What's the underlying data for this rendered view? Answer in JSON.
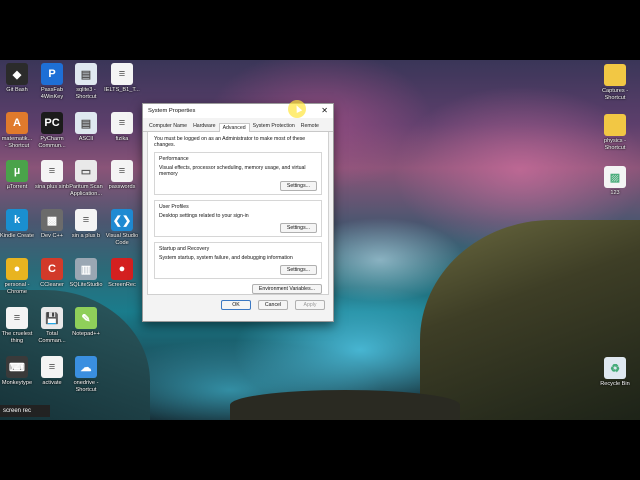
{
  "desktop": {
    "left_icons": [
      {
        "label": "Git Bash",
        "icon": "git-bash-icon",
        "color": "#2b2b2b",
        "glyph": "◆"
      },
      {
        "label": "PassFab\n4WinKey",
        "icon": "passfab-icon",
        "color": "#1e6fd6",
        "glyph": "P"
      },
      {
        "label": "sqlite3 -\nShortcut",
        "icon": "sqlite-icon",
        "color": "#dfe8f0",
        "glyph": "▤"
      },
      {
        "label": "IELTS_B1_T...",
        "icon": "document-icon",
        "color": "#f4f4f4",
        "glyph": "≡"
      },
      {
        "label": "matematik...\n- Shortcut",
        "icon": "pdf-icon",
        "color": "#e07a2c",
        "glyph": "A"
      },
      {
        "label": "PyCharm\nCommun...",
        "icon": "pycharm-icon",
        "color": "#1b1b1b",
        "glyph": "PC"
      },
      {
        "label": "ASCII",
        "icon": "ascii-icon",
        "color": "#dfe8f0",
        "glyph": "▤"
      },
      {
        "label": "fizika",
        "icon": "document-icon",
        "color": "#f4f4f4",
        "glyph": "≡"
      },
      {
        "label": "µTorrent",
        "icon": "utorrent-icon",
        "color": "#4aa34a",
        "glyph": "µ"
      },
      {
        "label": "sina plus sinb",
        "icon": "document-icon",
        "color": "#f4f4f4",
        "glyph": "≡"
      },
      {
        "label": "Paritum Scan\nApplication...",
        "icon": "scanner-icon",
        "color": "#e9e9e9",
        "glyph": "▭"
      },
      {
        "label": "passwords",
        "icon": "document-icon",
        "color": "#f4f4f4",
        "glyph": "≡"
      },
      {
        "label": "Kindle Create",
        "icon": "kindle-icon",
        "color": "#1a8fd0",
        "glyph": "k"
      },
      {
        "label": "Dev C++",
        "icon": "devcpp-icon",
        "color": "#6b6b6b",
        "glyph": "▩"
      },
      {
        "label": "sin a plus b",
        "icon": "document-icon",
        "color": "#f4f4f4",
        "glyph": "≡"
      },
      {
        "label": "Visual Studio\nCode",
        "icon": "vscode-icon",
        "color": "#1f8ad2",
        "glyph": "❮❯"
      },
      {
        "label": "personal -\nChrome",
        "icon": "chrome-icon",
        "color": "#e8b420",
        "glyph": "●"
      },
      {
        "label": "CCleaner",
        "icon": "ccleaner-icon",
        "color": "#d23a2a",
        "glyph": "C"
      },
      {
        "label": "SQLiteStudio",
        "icon": "sqlitestudio-icon",
        "color": "#9aa7b3",
        "glyph": "▥"
      },
      {
        "label": "ScreenRec",
        "icon": "screenrec-icon",
        "color": "#d42020",
        "glyph": "●"
      },
      {
        "label": "The cruelest\nthing",
        "icon": "document-icon",
        "color": "#f4f4f4",
        "glyph": "≡"
      },
      {
        "label": "Total\nComman...",
        "icon": "total-commander-icon",
        "color": "#e9e9e9",
        "glyph": "💾"
      },
      {
        "label": "Notepad++",
        "icon": "notepadpp-icon",
        "color": "#8fcf5a",
        "glyph": "✎"
      },
      {
        "label": "",
        "icon": "",
        "color": "",
        "glyph": ""
      },
      {
        "label": "Monkeytype",
        "icon": "monkeytype-icon",
        "color": "#3a3a3a",
        "glyph": "⌨"
      },
      {
        "label": "activate",
        "icon": "document-icon",
        "color": "#f4f4f4",
        "glyph": "≡"
      },
      {
        "label": "onedrive -\nShortcut",
        "icon": "onedrive-icon",
        "color": "#3a8fe0",
        "glyph": "☁"
      }
    ],
    "right_icons": [
      {
        "label": "Captures -\nShortcut",
        "icon": "folder-icon",
        "color": "#f2c744",
        "glyph": ""
      },
      {
        "label": "physics -\nShortcut",
        "icon": "folder-icon",
        "color": "#f2c744",
        "glyph": ""
      },
      {
        "label": "123",
        "icon": "image-file-icon",
        "color": "#f4f4f4",
        "glyph": "▨"
      },
      {
        "label": "Recycle Bin",
        "icon": "recycle-bin-icon",
        "color": "#dfe8f0",
        "glyph": "♻"
      }
    ],
    "watermark": "screen rec"
  },
  "dialog": {
    "title": "System Properties",
    "close_glyph": "✕",
    "tabs": [
      "Computer Name",
      "Hardware",
      "Advanced",
      "System Protection",
      "Remote"
    ],
    "active_tab": "Advanced",
    "admin_note": "You must be logged on as an Administrator to make most of these changes.",
    "performance": {
      "title": "Performance",
      "desc": "Visual effects, processor scheduling, memory usage, and virtual memory",
      "button": "Settings..."
    },
    "user_profiles": {
      "title": "User Profiles",
      "desc": "Desktop settings related to your sign-in",
      "button": "Settings..."
    },
    "startup_recovery": {
      "title": "Startup and Recovery",
      "desc": "System startup, system failure, and debugging information",
      "button": "Settings..."
    },
    "env_button": "Environment Variables...",
    "ok": "OK",
    "cancel": "Cancel",
    "apply": "Apply"
  },
  "colors": {
    "folder": "#f2c744",
    "accent": "#3b78c3",
    "cursor_highlight": "#ffe63c"
  }
}
